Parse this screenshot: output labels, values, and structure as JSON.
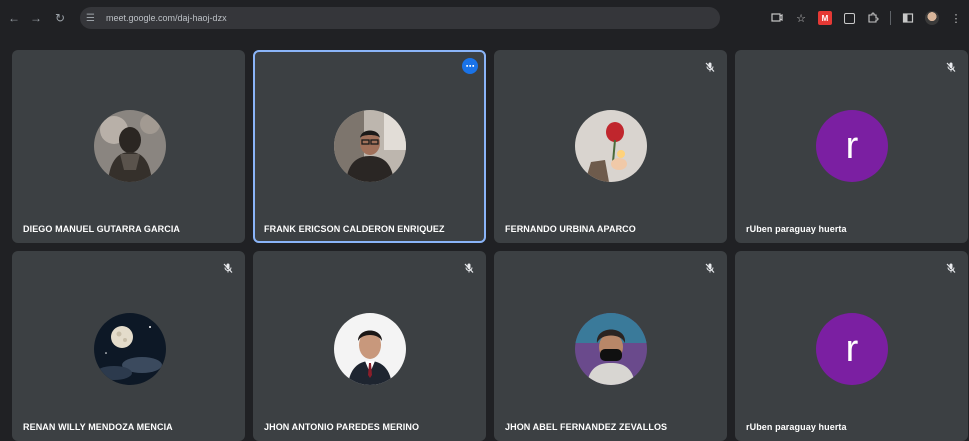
{
  "browser": {
    "url": "meet.google.com/daj-haoj-dzx",
    "icons": {
      "back": "back-arrow-icon",
      "forward": "forward-arrow-icon",
      "reload": "reload-icon",
      "site_info": "site-settings-icon"
    },
    "toolbar_icons": [
      "cast-icon",
      "bookmark-star-icon",
      "extension-red-icon",
      "extension-icon",
      "puzzle-icon",
      "side-panel-icon",
      "profile-icon",
      "menu-icon"
    ]
  },
  "participants": [
    {
      "name": "DIEGO MANUEL GUTARRA GARCIA",
      "avatar": "photo",
      "muted": false,
      "active": false
    },
    {
      "name": "FRANK ERICSON CALDERON ENRIQUEZ",
      "avatar": "photo",
      "muted": false,
      "active": true
    },
    {
      "name": "FERNANDO URBINA APARCO",
      "avatar": "photo",
      "muted": true,
      "active": false
    },
    {
      "name": "rUben paraguay huerta",
      "avatar": "letter",
      "letter": "r",
      "muted": true,
      "active": false
    },
    {
      "name": "RENAN WILLY MENDOZA MENCIA",
      "avatar": "photo",
      "muted": true,
      "active": false
    },
    {
      "name": "JHON ANTONIO PAREDES MERINO",
      "avatar": "photo",
      "muted": true,
      "active": false
    },
    {
      "name": "JHON ABEL FERNANDEZ ZEVALLOS",
      "avatar": "photo",
      "muted": true,
      "active": false
    },
    {
      "name": "rUben paraguay huerta",
      "avatar": "letter",
      "letter": "r",
      "muted": true,
      "active": false
    }
  ],
  "colors": {
    "background": "#202124",
    "tile": "#3c4043",
    "active_outline": "#8ab4f8",
    "letter_avatar": "#7b1fa2",
    "more_button": "#1a73e8"
  }
}
